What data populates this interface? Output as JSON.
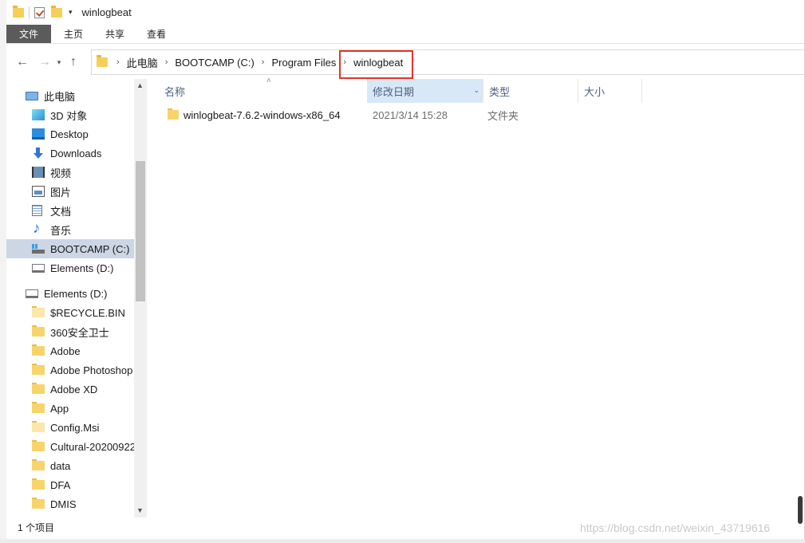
{
  "window": {
    "title": "winlogbeat"
  },
  "ribbon": {
    "tabs": [
      "文件",
      "主页",
      "共享",
      "查看"
    ]
  },
  "navigation": {
    "back_icon": "arrow-left-icon",
    "forward_icon": "arrow-right-icon",
    "history_icon": "chevron-down-icon",
    "up_icon": "arrow-up-icon"
  },
  "address_bar": {
    "crumbs": [
      "此电脑",
      "BOOTCAMP (C:)",
      "Program Files",
      "winlogbeat"
    ]
  },
  "sidebar": {
    "items": [
      {
        "label": "此电脑",
        "icon": "computer-icon"
      },
      {
        "label": "3D 对象",
        "icon": "3d-objects-icon"
      },
      {
        "label": "Desktop",
        "icon": "desktop-icon"
      },
      {
        "label": "Downloads",
        "icon": "download-icon"
      },
      {
        "label": "视频",
        "icon": "video-icon"
      },
      {
        "label": "图片",
        "icon": "pictures-icon"
      },
      {
        "label": "文档",
        "icon": "documents-icon"
      },
      {
        "label": "音乐",
        "icon": "music-icon"
      },
      {
        "label": "BOOTCAMP (C:)",
        "icon": "windows-drive-icon"
      },
      {
        "label": "Elements (D:)",
        "icon": "drive-icon"
      },
      {
        "label": "Elements (D:)",
        "icon": "drive-icon"
      },
      {
        "label": "$RECYCLE.BIN",
        "icon": "folder-icon"
      },
      {
        "label": "360安全卫士",
        "icon": "folder-icon"
      },
      {
        "label": "Adobe",
        "icon": "folder-icon"
      },
      {
        "label": "Adobe Photoshop",
        "icon": "folder-icon"
      },
      {
        "label": "Adobe XD",
        "icon": "folder-icon"
      },
      {
        "label": "App",
        "icon": "folder-icon"
      },
      {
        "label": "Config.Msi",
        "icon": "folder-icon"
      },
      {
        "label": "Cultural-20200922",
        "icon": "folder-icon"
      },
      {
        "label": "data",
        "icon": "folder-icon"
      },
      {
        "label": "DFA",
        "icon": "folder-icon"
      },
      {
        "label": "DMIS",
        "icon": "folder-icon"
      }
    ]
  },
  "columns": {
    "name": "名称",
    "date": "修改日期",
    "type": "类型",
    "size": "大小"
  },
  "files": [
    {
      "name": "winlogbeat-7.6.2-windows-x86_64",
      "date": "2021/3/14 15:28",
      "type": "文件夹",
      "size": ""
    }
  ],
  "status": {
    "item_count": "1 个项目"
  },
  "watermark": "https://blog.csdn.net/weixin_43719616",
  "colors": {
    "selection": "#ccd6e4",
    "sorted_column": "#d9e8f7",
    "highlight_box": "#e5332a",
    "file_tab": "#5b5b5b"
  }
}
